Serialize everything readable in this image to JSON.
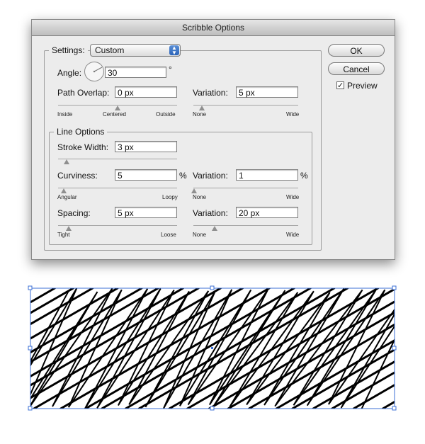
{
  "dialog": {
    "title": "Scribble Options",
    "settings_label": "Settings:",
    "settings_value": "Custom",
    "ok_label": "OK",
    "cancel_label": "Cancel",
    "preview_label": "Preview",
    "preview_checked": true,
    "angle_label": "Angle:",
    "angle_value": "30",
    "angle_unit": "°",
    "path_overlap_label": "Path Overlap:",
    "path_overlap_value": "0 px",
    "path_overlap_ticks": [
      "Inside",
      "Centered",
      "Outside"
    ],
    "path_overlap_variation_label": "Variation:",
    "path_overlap_variation_value": "5 px",
    "path_overlap_variation_ticks": [
      "None",
      "Wide"
    ],
    "line_options_label": "Line Options",
    "stroke_width_label": "Stroke Width:",
    "stroke_width_value": "3 px",
    "curviness_label": "Curviness:",
    "curviness_value": "5",
    "curviness_unit": "%",
    "curviness_ticks": [
      "Angular",
      "Loopy"
    ],
    "curviness_variation_label": "Variation:",
    "curviness_variation_value": "1",
    "curviness_variation_unit": "%",
    "curviness_variation_ticks": [
      "None",
      "Wide"
    ],
    "spacing_label": "Spacing:",
    "spacing_value": "5 px",
    "spacing_ticks": [
      "Tight",
      "Loose"
    ],
    "spacing_variation_label": "Variation:",
    "spacing_variation_value": "20 px",
    "spacing_variation_ticks": [
      "None",
      "Wide"
    ]
  },
  "slider_levels": {
    "path_overlap": 0.5,
    "path_overlap_variation": 0.08,
    "stroke_width": 0.07,
    "curviness": 0.05,
    "curviness_variation": 0.01,
    "spacing": 0.09,
    "spacing_variation": 0.2
  },
  "colors": {
    "dialog_bg": "#ececec",
    "selection_blue": "#3b6fd6",
    "stroke": "#000000"
  }
}
